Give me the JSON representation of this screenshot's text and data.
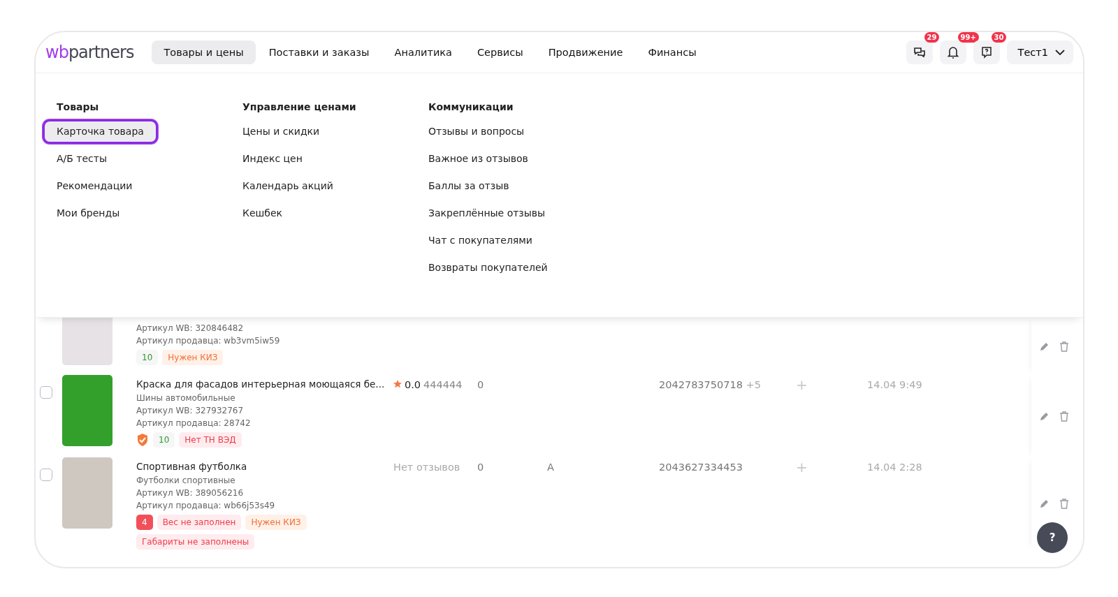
{
  "logo": {
    "prefix": "wb",
    "suffix": "partners"
  },
  "nav": [
    {
      "label": "Товары и цены",
      "selected": true
    },
    {
      "label": "Поставки и заказы",
      "selected": false
    },
    {
      "label": "Аналитика",
      "selected": false
    },
    {
      "label": "Сервисы",
      "selected": false
    },
    {
      "label": "Продвижение",
      "selected": false
    },
    {
      "label": "Финансы",
      "selected": false
    }
  ],
  "header_icons": [
    {
      "kind": "chat",
      "badge": "29"
    },
    {
      "kind": "bell",
      "badge": "99+"
    },
    {
      "kind": "help",
      "badge": "30"
    }
  ],
  "user": {
    "name": "Тест1"
  },
  "menu": {
    "columns": [
      {
        "title": "Товары",
        "items": [
          {
            "label": "Карточка товара",
            "selected": true
          },
          {
            "label": "А/Б тесты",
            "selected": false
          },
          {
            "label": "Рекомендации",
            "selected": false
          },
          {
            "label": "Мои бренды",
            "selected": false
          }
        ]
      },
      {
        "title": "Управление ценами",
        "items": [
          {
            "label": "Цены и скидки",
            "selected": false
          },
          {
            "label": "Индекс цен",
            "selected": false
          },
          {
            "label": "Календарь акций",
            "selected": false
          },
          {
            "label": "Кешбек",
            "selected": false
          }
        ]
      },
      {
        "title": "Коммуникации",
        "items": [
          {
            "label": "Отзывы и вопросы",
            "selected": false
          },
          {
            "label": "Важное из отзывов",
            "selected": false
          },
          {
            "label": "Баллы за отзыв",
            "selected": false
          },
          {
            "label": "Закреплённые отзывы",
            "selected": false
          },
          {
            "label": "Чат с покупателями",
            "selected": false
          },
          {
            "label": "Возвраты покупателей",
            "selected": false
          }
        ]
      }
    ]
  },
  "rows": [
    {
      "lines": [
        "Артикул WB: 320846482",
        "Артикул продавца: wb3vm5iw59"
      ],
      "tags": [
        {
          "kind": "count",
          "text": "10"
        },
        {
          "kind": "warn",
          "text": "Нужен КИЗ"
        }
      ]
    },
    {
      "checked": false,
      "title": "Краска для фасадов интерьерная моющаяся бе...",
      "lines": [
        "Шины автомобильные",
        "Артикул WB: 327932767",
        "Артикул продавца: 28742"
      ],
      "tags": [
        {
          "kind": "shield"
        },
        {
          "kind": "count",
          "text": "10"
        },
        {
          "kind": "error",
          "text": "Нет ТН ВЭД"
        }
      ],
      "rating": {
        "score": "0.0",
        "count": "444444"
      },
      "column_5": "0",
      "barcode": "2042783750718",
      "barcode_more": "+5",
      "plus": "+",
      "date": "14.04 9:49"
    },
    {
      "checked": false,
      "title": "Спортивная футболка",
      "lines": [
        "Футболки спортивные",
        "Артикул WB: 389056216",
        "Артикул продавца: wb66j53s49"
      ],
      "tags": [
        {
          "kind": "count-error",
          "text": "4"
        },
        {
          "kind": "error",
          "text": "Вес не заполнен"
        },
        {
          "kind": "warn",
          "text": "Нужен КИЗ"
        },
        {
          "kind": "error",
          "text": "Габариты не заполнены"
        }
      ],
      "no_reviews": "Нет отзывов",
      "column_5": "0",
      "column_6": "A",
      "barcode": "2043627334453",
      "plus": "+",
      "date": "14.04 2:28"
    }
  ],
  "help_button": "?"
}
